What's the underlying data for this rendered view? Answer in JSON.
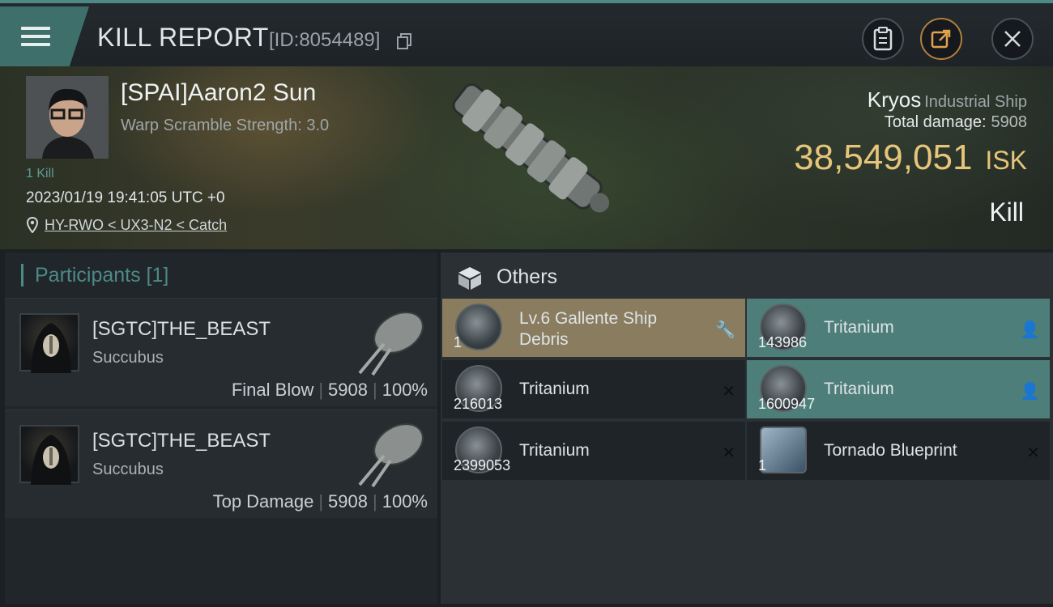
{
  "header": {
    "title": "KILL REPORT",
    "kill_id": "[ID:8054489]"
  },
  "victim": {
    "pilot_name": "[SPAI]Aaron2 Sun",
    "warp_scramble": "Warp Scramble Strength: 3.0",
    "kill_count": "1 Kill",
    "datetime": "2023/01/19 19:41:05 UTC +0",
    "location": "HY-RWO < UX3-N2 < Catch",
    "ship_name": "Kryos",
    "ship_class": "Industrial Ship",
    "total_damage_label": "Total damage:",
    "total_damage": "5908",
    "isk_value": "38,549,051",
    "isk_unit": "ISK",
    "outcome": "Kill"
  },
  "participants": {
    "title": "Participants [1]",
    "rows": [
      {
        "name": "[SGTC]THE_BEAST",
        "ship": "Succubus",
        "role": "Final Blow",
        "damage": "5908",
        "percent": "100%"
      },
      {
        "name": "[SGTC]THE_BEAST",
        "ship": "Succubus",
        "role": "Top Damage",
        "damage": "5908",
        "percent": "100%"
      }
    ]
  },
  "others": {
    "title": "Others",
    "items": [
      {
        "label_line1": "Lv.6 Gallente Ship",
        "label_line2": "Debris",
        "qty": "1",
        "state": "dropped",
        "action_icon": "wrench-icon",
        "action_glyph": "🔧"
      },
      {
        "label": "Tritanium",
        "qty": "143986",
        "state": "dropped",
        "action_icon": "person-icon",
        "action_glyph": "👤"
      },
      {
        "label": "Tritanium",
        "qty": "216013",
        "state": "destroyed",
        "action_icon": "close-icon",
        "action_glyph": "✕"
      },
      {
        "label": "Tritanium",
        "qty": "1600947",
        "state": "dropped",
        "action_icon": "person-icon",
        "action_glyph": "👤"
      },
      {
        "label": "Tritanium",
        "qty": "2399053",
        "state": "destroyed",
        "action_icon": "close-icon",
        "action_glyph": "✕"
      },
      {
        "label": "Tornado Blueprint",
        "qty": "1",
        "state": "destroyed",
        "action_icon": "close-icon",
        "action_glyph": "✕"
      }
    ]
  },
  "colors": {
    "accent_teal": "#4e7e7a",
    "isk_gold": "#e6c57a",
    "item_gold": "#8a7d5f",
    "header_tab": "#3e6f6b"
  }
}
